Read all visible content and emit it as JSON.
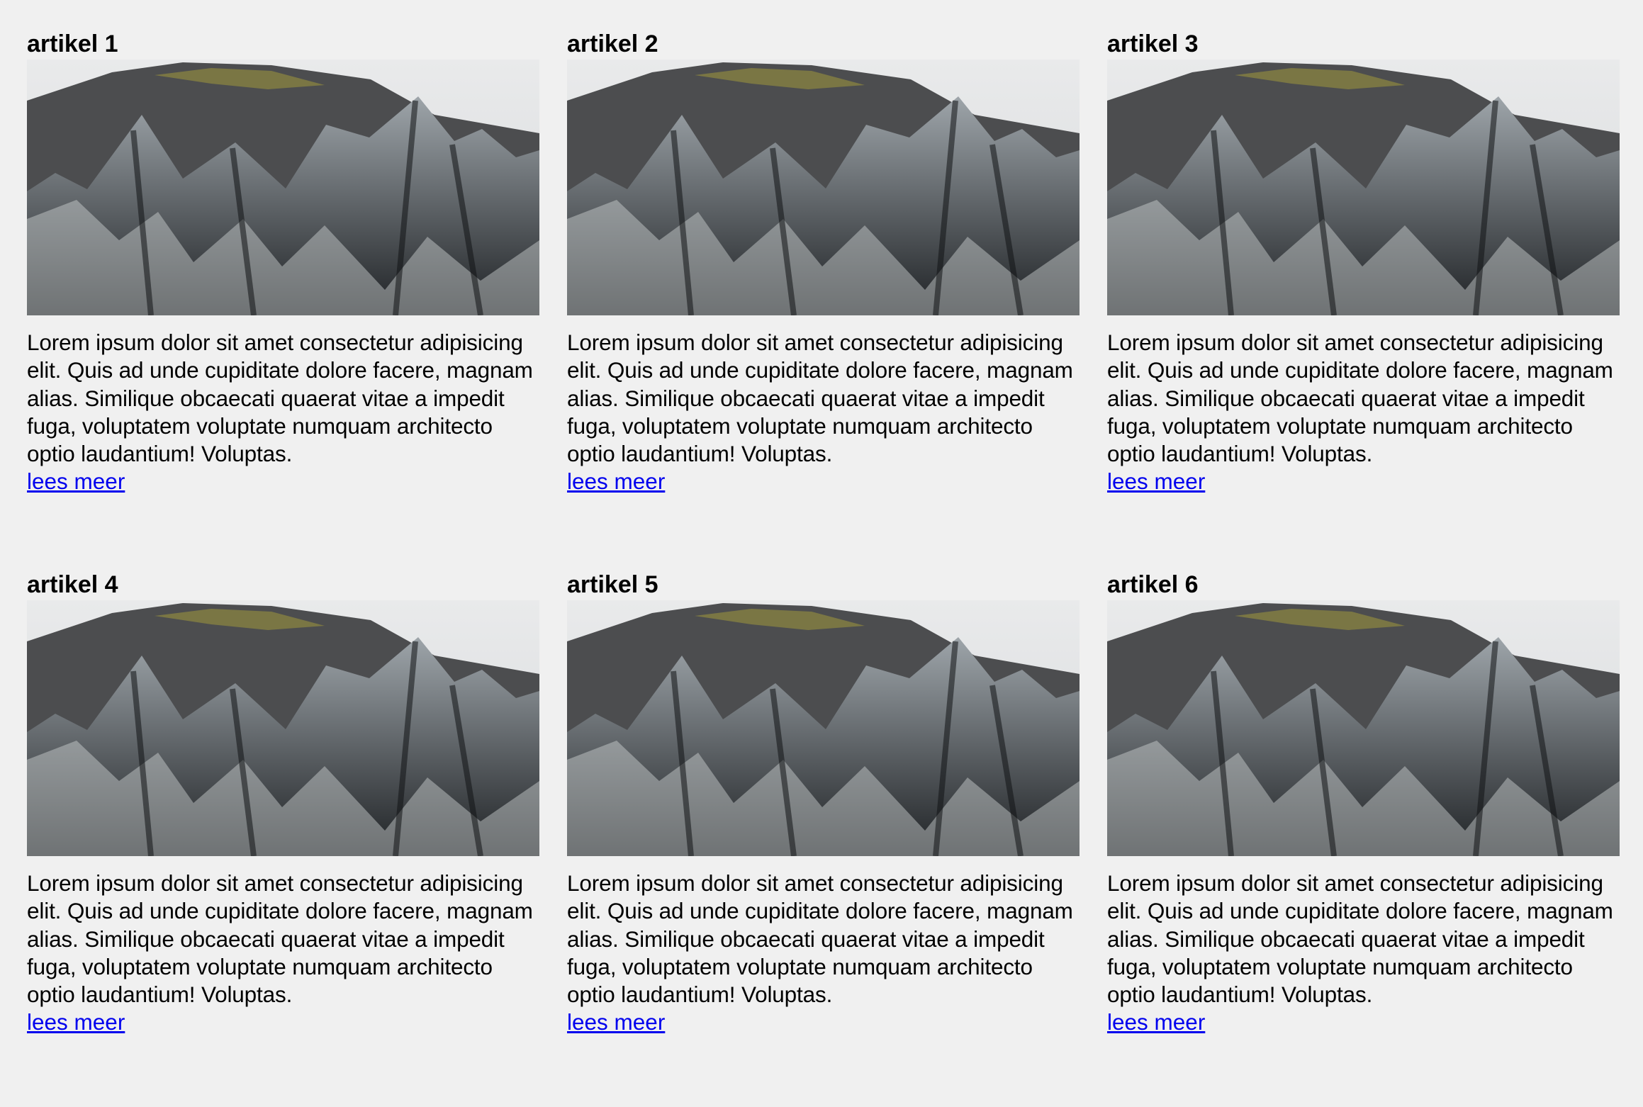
{
  "articles": [
    {
      "title": "artikel 1",
      "text": "Lorem ipsum dolor sit amet consectetur adipisicing elit. Quis ad unde cupiditate dolore facere, magnam alias. Similique obcaecati quaerat vitae a impedit fuga, voluptatem voluptate numquam architecto optio laudantium! Voluptas.",
      "link": "lees meer"
    },
    {
      "title": "artikel 2",
      "text": "Lorem ipsum dolor sit amet consectetur adipisicing elit. Quis ad unde cupiditate dolore facere, magnam alias. Similique obcaecati quaerat vitae a impedit fuga, voluptatem voluptate numquam architecto optio laudantium! Voluptas.",
      "link": "lees meer"
    },
    {
      "title": "artikel 3",
      "text": "Lorem ipsum dolor sit amet consectetur adipisicing elit. Quis ad unde cupiditate dolore facere, magnam alias. Similique obcaecati quaerat vitae a impedit fuga, voluptatem voluptate numquam architecto optio laudantium! Voluptas.",
      "link": "lees meer"
    },
    {
      "title": "artikel 4",
      "text": "Lorem ipsum dolor sit amet consectetur adipisicing elit. Quis ad unde cupiditate dolore facere, magnam alias. Similique obcaecati quaerat vitae a impedit fuga, voluptatem voluptate numquam architecto optio laudantium! Voluptas.",
      "link": "lees meer"
    },
    {
      "title": "artikel 5",
      "text": "Lorem ipsum dolor sit amet consectetur adipisicing elit. Quis ad unde cupiditate dolore facere, magnam alias. Similique obcaecati quaerat vitae a impedit fuga, voluptatem voluptate numquam architecto optio laudantium! Voluptas.",
      "link": "lees meer"
    },
    {
      "title": "artikel 6",
      "text": "Lorem ipsum dolor sit amet consectetur adipisicing elit. Quis ad unde cupiditate dolore facere, magnam alias. Similique obcaecati quaerat vitae a impedit fuga, voluptatem voluptate numquam architecto optio laudantium! Voluptas.",
      "link": "lees meer"
    }
  ],
  "colors": {
    "background": "#f0f0f0",
    "link": "#0000ee",
    "text": "#000000"
  }
}
